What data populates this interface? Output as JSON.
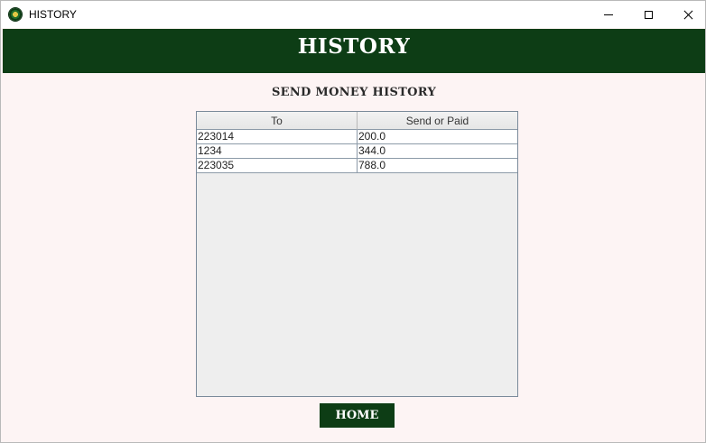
{
  "window": {
    "title": "HISTORY",
    "controls": {
      "minimize": "minimize",
      "maximize": "maximize",
      "close": "close"
    }
  },
  "header": {
    "title": "HISTORY"
  },
  "section": {
    "title": "SEND MONEY HISTORY"
  },
  "table": {
    "columns": [
      "To",
      "Send or Paid"
    ],
    "rows": [
      [
        "223014",
        "200.0"
      ],
      [
        "1234",
        "344.0"
      ],
      [
        "223035",
        "788.0"
      ]
    ]
  },
  "home_button": {
    "label": "HOME"
  },
  "colors": {
    "brand": "#0d3d15",
    "background": "#fdf4f4",
    "table_empty": "#eeeeee"
  },
  "icons": {
    "app": "app-logo-icon",
    "minimize": "minimize-icon",
    "maximize": "maximize-icon",
    "close": "close-icon"
  }
}
